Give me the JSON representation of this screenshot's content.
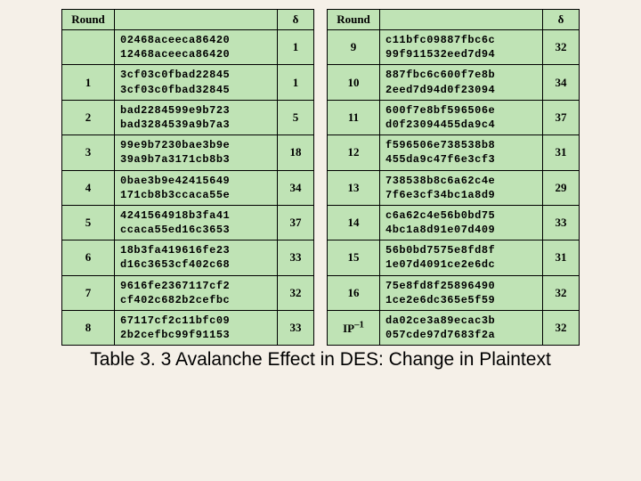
{
  "headers": {
    "round": "Round",
    "delta": "δ"
  },
  "left": [
    {
      "round": "",
      "h1": "02468aceeca86420",
      "h2": "12468aceeca86420",
      "d": "1"
    },
    {
      "round": "1",
      "h1": "3cf03c0fbad22845",
      "h2": "3cf03c0fbad32845",
      "d": "1"
    },
    {
      "round": "2",
      "h1": "bad2284599e9b723",
      "h2": "bad3284539a9b7a3",
      "d": "5"
    },
    {
      "round": "3",
      "h1": "99e9b7230bae3b9e",
      "h2": "39a9b7a3171cb8b3",
      "d": "18"
    },
    {
      "round": "4",
      "h1": "0bae3b9e42415649",
      "h2": "171cb8b3ccaca55e",
      "d": "34"
    },
    {
      "round": "5",
      "h1": "4241564918b3fa41",
      "h2": "ccaca55ed16c3653",
      "d": "37"
    },
    {
      "round": "6",
      "h1": "18b3fa419616fe23",
      "h2": "d16c3653cf402c68",
      "d": "33"
    },
    {
      "round": "7",
      "h1": "9616fe2367117cf2",
      "h2": "cf402c682b2cefbc",
      "d": "32"
    },
    {
      "round": "8",
      "h1": "67117cf2c11bfc09",
      "h2": "2b2cefbc99f91153",
      "d": "33"
    }
  ],
  "right": [
    {
      "round": "9",
      "h1": "c11bfc09887fbc6c",
      "h2": "99f911532eed7d94",
      "d": "32"
    },
    {
      "round": "10",
      "h1": "887fbc6c600f7e8b",
      "h2": "2eed7d94d0f23094",
      "d": "34"
    },
    {
      "round": "11",
      "h1": "600f7e8bf596506e",
      "h2": "d0f23094455da9c4",
      "d": "37"
    },
    {
      "round": "12",
      "h1": "f596506e738538b8",
      "h2": "455da9c47f6e3cf3",
      "d": "31"
    },
    {
      "round": "13",
      "h1": "738538b8c6a62c4e",
      "h2": "7f6e3cf34bc1a8d9",
      "d": "29"
    },
    {
      "round": "14",
      "h1": "c6a62c4e56b0bd75",
      "h2": "4bc1a8d91e07d409",
      "d": "33"
    },
    {
      "round": "15",
      "h1": "56b0bd7575e8fd8f",
      "h2": "1e07d4091ce2e6dc",
      "d": "31"
    },
    {
      "round": "16",
      "h1": "75e8fd8f25896490",
      "h2": "1ce2e6dc365e5f59",
      "d": "32"
    },
    {
      "round": "IP–1",
      "h1": "da02ce3a89ecac3b",
      "h2": "057cde97d7683f2a",
      "d": "32"
    }
  ],
  "caption": "Table 3. 3  Avalanche Effect in DES: Change in Plaintext"
}
